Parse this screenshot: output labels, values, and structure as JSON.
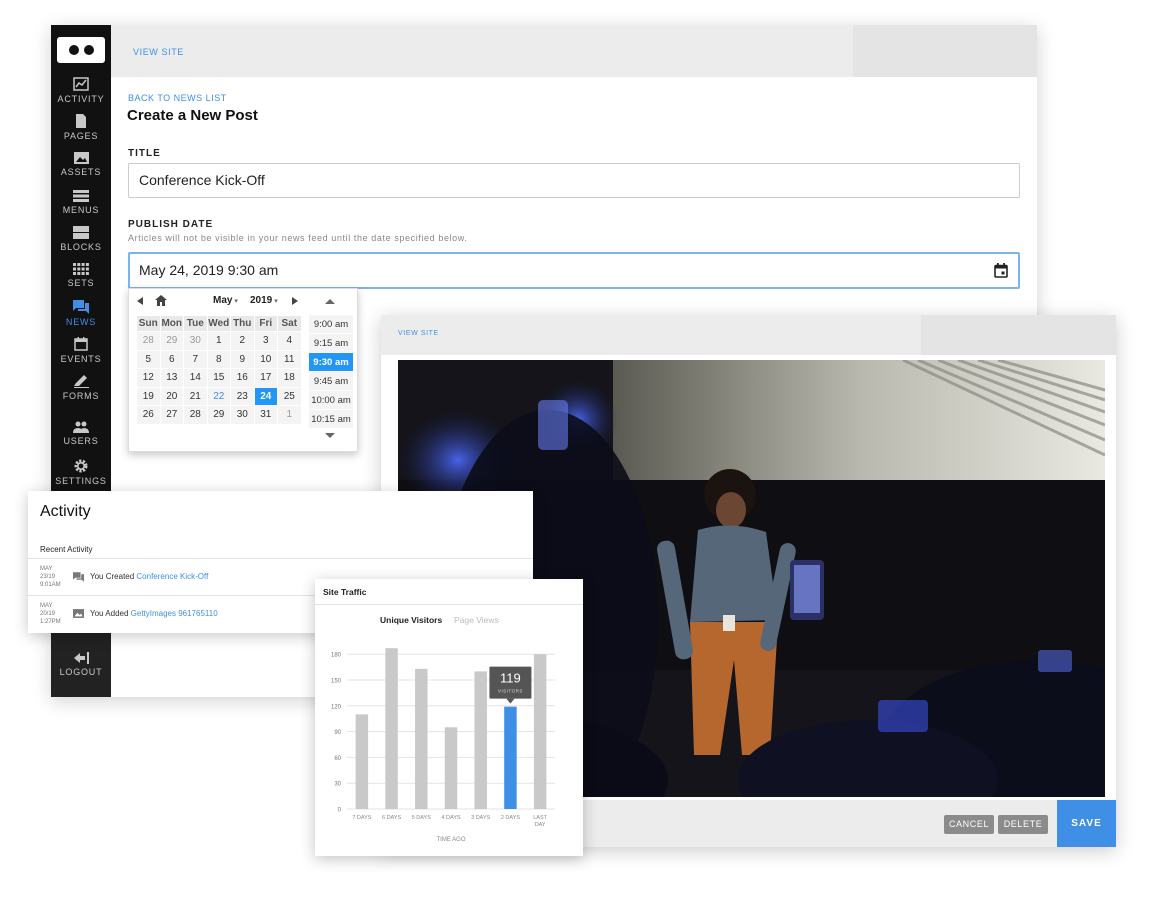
{
  "main": {
    "view_site": "VIEW SITE",
    "back_link": "BACK TO NEWS LIST",
    "page_title": "Create a New Post",
    "title_label": "TITLE",
    "title_value": "Conference Kick-Off",
    "publish_label": "PUBLISH DATE",
    "publish_help": "Articles will not be visible in your news feed until the date specified below.",
    "publish_value": "May 24, 2019 9:30 am"
  },
  "sidebar": {
    "items": [
      {
        "label": "ACTIVITY",
        "icon": "activity-chart-icon"
      },
      {
        "label": "PAGES",
        "icon": "page-icon"
      },
      {
        "label": "ASSETS",
        "icon": "image-icon"
      },
      {
        "label": "MENUS",
        "icon": "menu-list-icon"
      },
      {
        "label": "BLOCKS",
        "icon": "blocks-icon"
      },
      {
        "label": "SETS",
        "icon": "grid-icon"
      },
      {
        "label": "NEWS",
        "icon": "news-chat-icon"
      },
      {
        "label": "EVENTS",
        "icon": "calendar-icon"
      },
      {
        "label": "FORMS",
        "icon": "pencil-icon"
      },
      {
        "label": "USERS",
        "icon": "users-icon"
      },
      {
        "label": "SETTINGS",
        "icon": "gear-icon"
      }
    ],
    "active": "NEWS",
    "logout": "LOGOUT"
  },
  "datepicker": {
    "month": "May",
    "year": "2019",
    "weekdays": [
      "Sun",
      "Mon",
      "Tue",
      "Wed",
      "Thu",
      "Fri",
      "Sat"
    ],
    "weeks": [
      [
        "28",
        "29",
        "30",
        "1",
        "2",
        "3",
        "4"
      ],
      [
        "5",
        "6",
        "7",
        "8",
        "9",
        "10",
        "11"
      ],
      [
        "12",
        "13",
        "14",
        "15",
        "16",
        "17",
        "18"
      ],
      [
        "19",
        "20",
        "21",
        "22",
        "23",
        "24",
        "25"
      ],
      [
        "26",
        "27",
        "28",
        "29",
        "30",
        "31",
        "1"
      ]
    ],
    "today": "22",
    "selected_day": "24",
    "times": [
      "9:00 am",
      "9:15 am",
      "9:30 am",
      "9:45 am",
      "10:00 am",
      "10:15 am"
    ],
    "selected_time": "9:30 am"
  },
  "image_window": {
    "view_site": "VIEW SITE",
    "cancel": "CANCEL",
    "delete": "DELETE",
    "save": "SAVE"
  },
  "activity": {
    "title": "Activity",
    "recent_label": "Recent Activity",
    "rows": [
      {
        "date_line1": "MAY",
        "date_line2": "23/19",
        "date_line3": "9:01AM",
        "text": "You Created ",
        "link": "Conference Kick-Off",
        "icon": "news-chat-icon"
      },
      {
        "date_line1": "MAY",
        "date_line2": "20/19",
        "date_line3": "1:27PM",
        "text": "You Added ",
        "link": "GettyImages 961765110",
        "icon": "image-icon"
      }
    ]
  },
  "traffic": {
    "title": "Site Traffic",
    "tab_active": "Unique Visitors",
    "tab_inactive": "Page Views",
    "tooltip_value": "119",
    "tooltip_label": "VISITORS"
  },
  "chart_data": {
    "type": "bar",
    "categories": [
      "7 DAYS",
      "6 DAYS",
      "5 DAYS",
      "4 DAYS",
      "3 DAYS",
      "2 DAYS",
      "LAST DAY"
    ],
    "values": [
      110,
      187,
      163,
      95,
      160,
      119,
      180
    ],
    "highlight_index": 5,
    "highlight_color": "#3f8fe6",
    "bar_color": "#c9c9c9",
    "xlabel": "TIME AGO",
    "ylabel": "",
    "yticks": [
      0,
      30,
      60,
      90,
      120,
      150,
      180
    ],
    "ylim": [
      0,
      200
    ],
    "grid": true
  }
}
